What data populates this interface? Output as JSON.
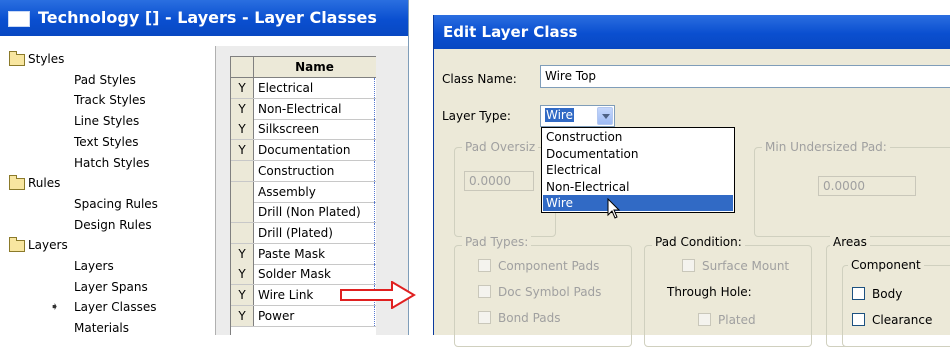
{
  "left_window": {
    "title": "Technology [] - Layers - Layer Classes",
    "tree": [
      {
        "label": "Styles",
        "level": 0,
        "folder": true
      },
      {
        "label": "Pad Styles",
        "level": 1
      },
      {
        "label": "Track Styles",
        "level": 1
      },
      {
        "label": "Line Styles",
        "level": 1
      },
      {
        "label": "Text Styles",
        "level": 1
      },
      {
        "label": "Hatch Styles",
        "level": 1
      },
      {
        "label": "Rules",
        "level": 0,
        "folder": true
      },
      {
        "label": "Spacing Rules",
        "level": 1
      },
      {
        "label": "Design Rules",
        "level": 1
      },
      {
        "label": "Layers",
        "level": 0,
        "folder": true
      },
      {
        "label": "Layers",
        "level": 1
      },
      {
        "label": "Layer Spans",
        "level": 1
      },
      {
        "label": "Layer Classes",
        "level": 1,
        "current": true
      },
      {
        "label": "Materials",
        "level": 1
      }
    ],
    "grid": {
      "header": "Name",
      "rows": [
        {
          "flag": "Y",
          "name": "Electrical"
        },
        {
          "flag": "Y",
          "name": "Non-Electrical"
        },
        {
          "flag": "Y",
          "name": "Silkscreen"
        },
        {
          "flag": "Y",
          "name": "Documentation"
        },
        {
          "flag": "",
          "name": "Construction"
        },
        {
          "flag": "",
          "name": "Assembly"
        },
        {
          "flag": "",
          "name": "Drill (Non Plated)"
        },
        {
          "flag": "",
          "name": "Drill (Plated)"
        },
        {
          "flag": "Y",
          "name": "Paste Mask"
        },
        {
          "flag": "Y",
          "name": "Solder Mask"
        },
        {
          "flag": "Y",
          "name": "Wire Link"
        },
        {
          "flag": "Y",
          "name": "Power"
        }
      ]
    }
  },
  "dialog": {
    "title": "Edit Layer Class",
    "class_name_label": "Class Name:",
    "class_name_value": "Wire Top",
    "layer_type_label": "Layer Type:",
    "layer_type_value": "Wire",
    "layer_type_options": [
      "Construction",
      "Documentation",
      "Electrical",
      "Non-Electrical",
      "Wire"
    ],
    "layer_type_highlighted": "Wire",
    "pad_oversize_label": "Pad Oversiz",
    "pad_oversize_value": "0.0000",
    "min_undersized_label": "Min Undersized Pad:",
    "min_undersized_value": "0.0000",
    "pad_types": {
      "label": "Pad Types:",
      "items": [
        "Component Pads",
        "Doc Symbol Pads",
        "Bond Pads"
      ]
    },
    "pad_condition": {
      "label": "Pad Condition:",
      "surface_mount": "Surface Mount",
      "through_hole": "Through Hole:",
      "plated": "Plated"
    },
    "areas": {
      "label": "Areas",
      "component_label": "Component",
      "items": [
        "Body",
        "Clearance"
      ]
    }
  },
  "colors": {
    "title_bar": "#0a4fd0",
    "dialog_bg": "#ece9d8",
    "selection": "#316ac5",
    "arrow": "#e02020"
  }
}
